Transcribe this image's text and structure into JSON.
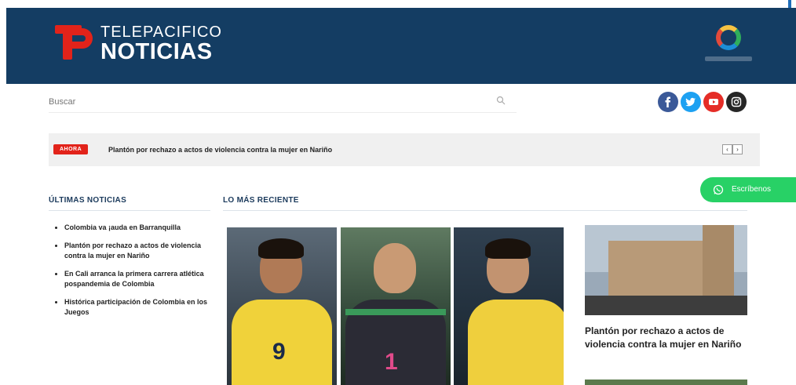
{
  "brand": {
    "line1": "TELEPACIFICO",
    "line2": "NOTICIAS"
  },
  "search": {
    "placeholder": "Buscar"
  },
  "social": [
    "facebook-icon",
    "twitter-icon",
    "youtube-icon",
    "instagram-icon"
  ],
  "ticker": {
    "badge": "AHORA",
    "headline": "Plantón por rechazo a actos de violencia contra la mujer en Nariño",
    "prev": "‹",
    "next": "›"
  },
  "whatsapp": {
    "label": "Escríbenos"
  },
  "sections": {
    "latest": "ÚLTIMAS NOTICIAS",
    "recent": "LO MÁS RECIENTE"
  },
  "latest_news": [
    "Colombia va ¡auda en Barranquilla",
    "Plantón por rechazo a actos de violencia contra la mujer en Nariño",
    "En Cali arranca la primera carrera atlética pospandemia de Colombia",
    "Histórica participación de Colombia en los Juegos"
  ],
  "photos": {
    "p1_num": "9",
    "p2_num": "1"
  },
  "feature": {
    "title": "Plantón por rechazo a actos de violencia contra la mujer en Nariño"
  },
  "colors": {
    "header": "#143d63",
    "accent": "#e2231a",
    "whatsapp": "#28d166"
  }
}
